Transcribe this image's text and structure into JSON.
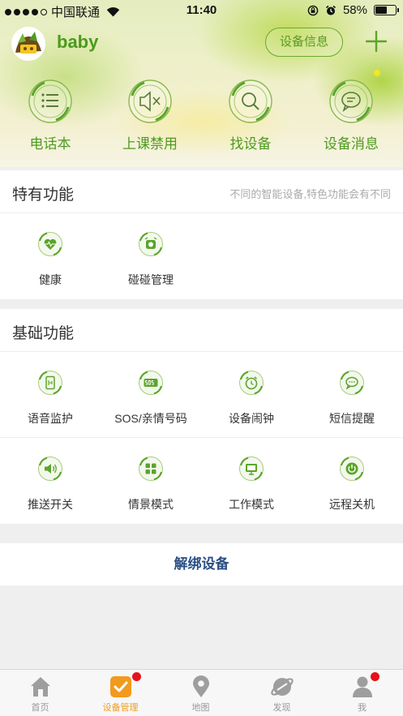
{
  "status_bar": {
    "carrier": "中国联通",
    "time": "11:40",
    "battery": "58%",
    "battery_level": 0.58
  },
  "header": {
    "device_name": "baby",
    "device_info_label": "设备信息",
    "quick_actions": [
      {
        "label": "电话本",
        "icon": "phonebook-icon"
      },
      {
        "label": "上课禁用",
        "icon": "mute-icon"
      },
      {
        "label": "找设备",
        "icon": "search-icon"
      },
      {
        "label": "设备消息",
        "icon": "message-icon"
      }
    ]
  },
  "special": {
    "title": "特有功能",
    "hint": "不同的智能设备,特色功能会有不同",
    "items": [
      {
        "label": "健康",
        "icon": "health-heart-icon"
      },
      {
        "label": "碰碰管理",
        "icon": "bump-icon"
      }
    ]
  },
  "basic": {
    "title": "基础功能",
    "items": [
      {
        "label": "语音监护",
        "icon": "voice-monitor-icon"
      },
      {
        "label": "SOS/亲情号码",
        "icon": "sos-icon"
      },
      {
        "label": "设备闹钟",
        "icon": "alarm-clock-icon"
      },
      {
        "label": "短信提醒",
        "icon": "sms-icon"
      },
      {
        "label": "推送开关",
        "icon": "push-speaker-icon"
      },
      {
        "label": "情景模式",
        "icon": "scene-mode-icon"
      },
      {
        "label": "工作模式",
        "icon": "work-mode-icon"
      },
      {
        "label": "远程关机",
        "icon": "power-icon"
      }
    ]
  },
  "unbind_label": "解绑设备",
  "tabbar": {
    "items": [
      {
        "label": "首页",
        "icon": "home-icon"
      },
      {
        "label": "设备管理",
        "icon": "device-manage-icon"
      },
      {
        "label": "地图",
        "icon": "map-pin-icon"
      },
      {
        "label": "发现",
        "icon": "discover-icon"
      },
      {
        "label": "我",
        "icon": "user-icon"
      }
    ]
  },
  "colors": {
    "accent_green": "#5aa52a",
    "title_green": "#4c9a1e",
    "active_orange": "#f29a1e",
    "badge_red": "#e8101a",
    "unbind_blue": "#2a4f86"
  }
}
